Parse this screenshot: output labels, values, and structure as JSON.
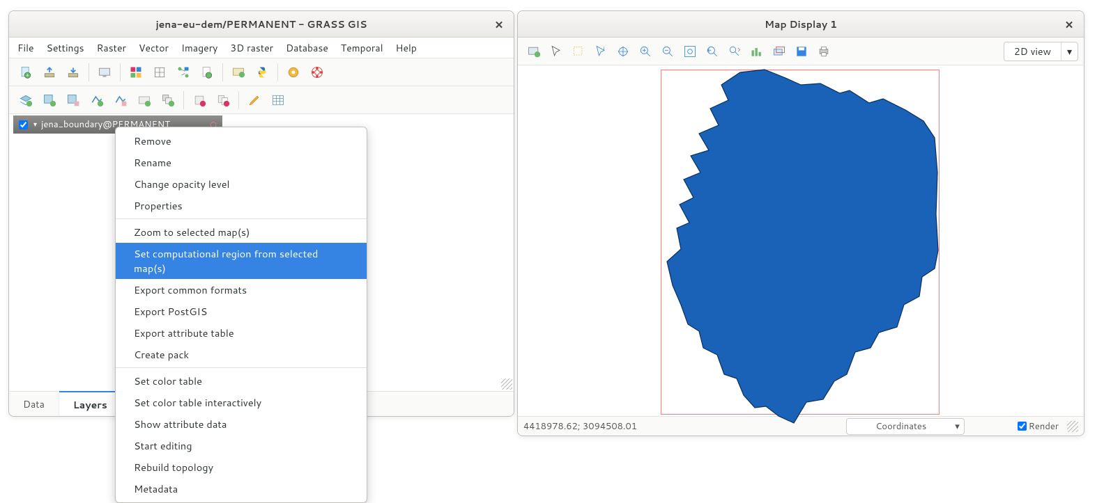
{
  "main_window": {
    "title": "jena-eu-dem/PERMANENT - GRASS GIS",
    "menus": [
      "File",
      "Settings",
      "Raster",
      "Vector",
      "Imagery",
      "3D raster",
      "Database",
      "Temporal",
      "Help"
    ],
    "layer_item": "jena_boundary@PERMANENT",
    "tabs": {
      "data": "Data",
      "layers": "Layers"
    },
    "context_menu": {
      "remove": "Remove",
      "rename": "Rename",
      "opacity": "Change opacity level",
      "properties": "Properties",
      "zoom_sel": "Zoom to selected map(s)",
      "set_region": "Set computational region from selected map(s)",
      "export_common": "Export common formats",
      "export_postgis": "Export PostGIS",
      "export_attr": "Export attribute table",
      "create_pack": "Create pack",
      "color_table": "Set color table",
      "color_inter": "Set color table interactively",
      "show_attr": "Show attribute data",
      "start_edit": "Start editing",
      "rebuild": "Rebuild topology",
      "metadata": "Metadata"
    }
  },
  "map_window": {
    "title": "Map Display 1",
    "view_mode": "2D view",
    "coords": "4418978.62; 3094508.01",
    "status_selector": "Coordinates",
    "render_label": "Render"
  },
  "colors": {
    "highlight": "#3584e4",
    "region_border": "#ff7a7a",
    "polygon_fill": "#1a62b7",
    "polygon_stroke": "#0a2f5a"
  }
}
